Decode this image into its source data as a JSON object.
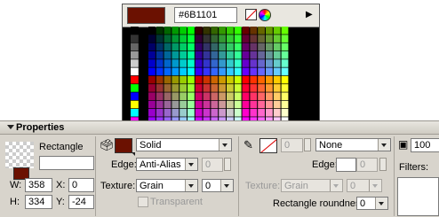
{
  "colors": {
    "current": "#6B1101",
    "panel_bg": "#d8d4cc"
  },
  "color_popup": {
    "hex_value": "#6B1101",
    "no_color_icon": "no-color-icon",
    "color_wheel_icon": "color-wheel-icon",
    "menu_arrow": "▶"
  },
  "properties": {
    "title": "Properties",
    "shape_type": "Rectangle",
    "instance_name": "",
    "W_label": "W:",
    "W_value": "358",
    "H_label": "H:",
    "H_value": "334",
    "X_label": "X:",
    "X_value": "0",
    "Y_label": "Y:",
    "Y_value": "-24",
    "fill": {
      "style": "Solid",
      "edge_label": "Edge:",
      "edge_value": "Anti-Alias",
      "edge_amount": "0",
      "texture_label": "Texture:",
      "texture_value": "Grain",
      "texture_amount": "0",
      "transparent_label": "Transparent"
    },
    "stroke": {
      "width": "0",
      "style": "None",
      "edge_label": "Edge:",
      "edge_amount": "0",
      "texture_label": "Texture:",
      "texture_value": "Grain",
      "texture_amount": "0",
      "roundness_label": "Rectangle roundness:",
      "roundness_value": "0"
    },
    "opacity_value": "100",
    "filters_label": "Filters:"
  }
}
